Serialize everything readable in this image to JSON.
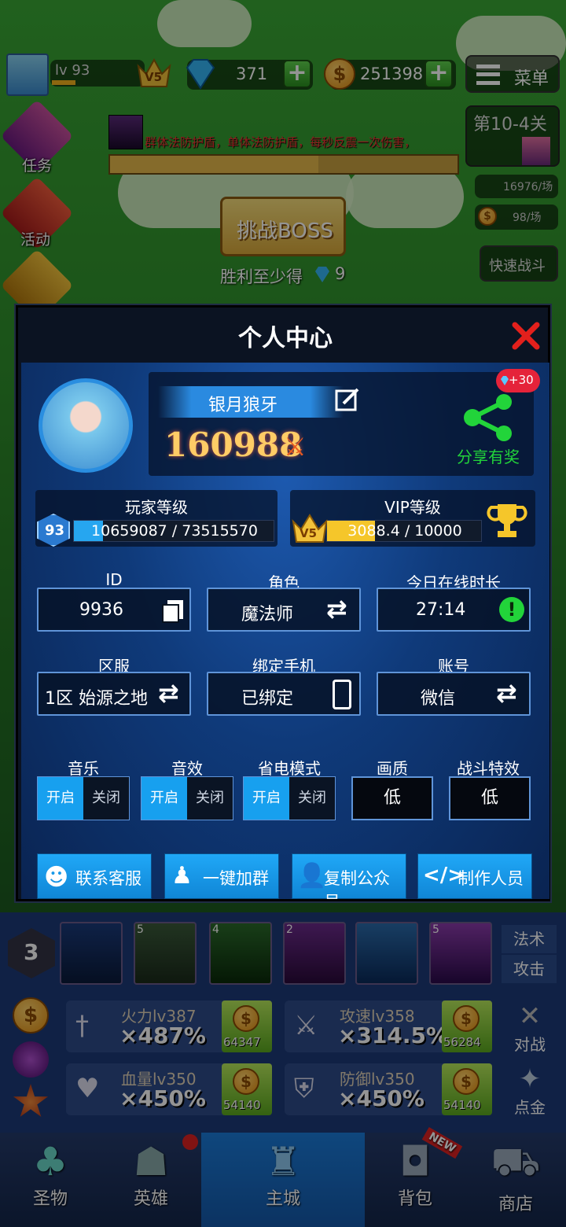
{
  "top_bar": {
    "level": "lv 93",
    "vip": "V5",
    "gems": "371",
    "gold": "251398",
    "menu_label": "菜单"
  },
  "side_menu": {
    "task": "任务",
    "activity": "活动"
  },
  "banner": {
    "text": "群体法防护盾，单体法防护盾，每秒反震一次伤害，"
  },
  "stage": {
    "label": "第10-4关",
    "exp_rate": "16976/场",
    "gold_rate": "98/场",
    "quick_battle": "快速战斗"
  },
  "boss": {
    "button": "挑战BOSS",
    "reward_text": "胜利至少得",
    "reward_count": "9"
  },
  "modal": {
    "title": "个人中心",
    "name": "银月狼牙",
    "power": "160988",
    "share_badge": "+30",
    "share_label": "分享有奖",
    "player_level_label": "玩家等级",
    "player_level": "93",
    "player_exp": "10659087 / 73515570",
    "player_exp_fraction": 0.145,
    "vip_label": "VIP等级",
    "vip_level": "V5",
    "vip_exp": "3088.4 / 10000",
    "vip_exp_fraction": 0.31,
    "fields": {
      "id_label": "ID",
      "id_value": "9936",
      "role_label": "角色",
      "role_value": "魔法师",
      "online_label": "今日在线时长",
      "online_value": "27:14",
      "server_label": "区服",
      "server_value": "1区 始源之地",
      "phone_label": "绑定手机",
      "phone_value": "已绑定",
      "account_label": "账号",
      "account_value": "微信"
    },
    "settings": {
      "music": "音乐",
      "sound": "音效",
      "power_save": "省电模式",
      "quality": "画质",
      "battle_fx": "战斗特效",
      "on": "开启",
      "off": "关闭",
      "quality_value": "低",
      "battle_fx_value": "低"
    },
    "buttons": {
      "support": "联系客服",
      "join_group": "一键加群",
      "copy_account": "复制公众号",
      "credits": "制作人员"
    }
  },
  "skills": {
    "slot_count": "3",
    "levels": [
      "5",
      "4",
      "2",
      "5"
    ],
    "tab_magic": "法术",
    "tab_attack": "攻击"
  },
  "stats": [
    {
      "name": "火力lv387",
      "value": "×487%",
      "cost": "64347"
    },
    {
      "name": "攻速lv358",
      "value": "×314.5%",
      "cost": "56284"
    },
    {
      "name": "血量lv350",
      "value": "×450%",
      "cost": "54140"
    },
    {
      "name": "防御lv350",
      "value": "×450%",
      "cost": "54140"
    }
  ],
  "right_actions": {
    "battle": "对战",
    "gold": "点金"
  },
  "nav": {
    "relic": "圣物",
    "hero": "英雄",
    "city": "主城",
    "bag": "背包",
    "shop": "商店",
    "new_badge": "NEW"
  },
  "colors": {
    "accent": "#17a0ef",
    "power": "#ffcc66",
    "share_green": "#22d43a"
  }
}
